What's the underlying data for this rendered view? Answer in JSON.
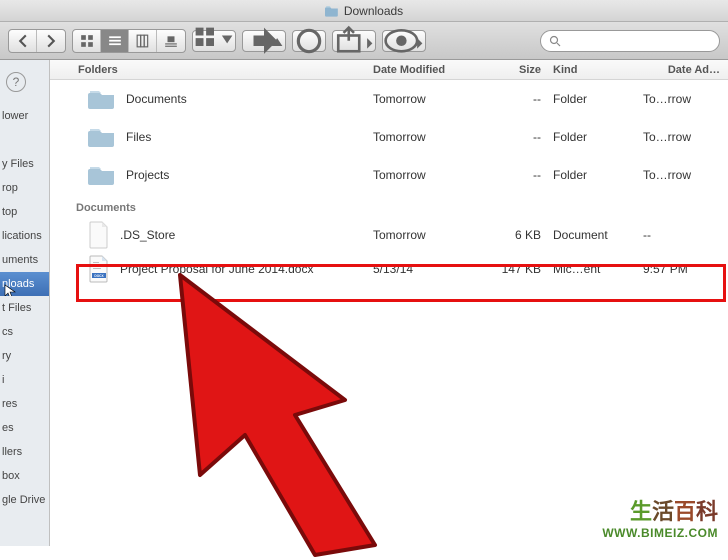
{
  "window": {
    "title": "Downloads"
  },
  "toolbar": {
    "search_placeholder": ""
  },
  "sidebar": {
    "items": [
      {
        "label": "lower"
      },
      {
        "label": ""
      },
      {
        "label": "y Files"
      },
      {
        "label": "rop"
      },
      {
        "label": "top"
      },
      {
        "label": "lications"
      },
      {
        "label": "uments"
      },
      {
        "label": "nloads"
      },
      {
        "label": "t Files"
      },
      {
        "label": "cs"
      },
      {
        "label": "ry"
      },
      {
        "label": "i"
      },
      {
        "label": "res"
      },
      {
        "label": "es"
      },
      {
        "label": "llers"
      },
      {
        "label": "box"
      },
      {
        "label": "gle Drive"
      }
    ],
    "selected_index": 7
  },
  "columns": {
    "folders_label": "Folders",
    "date_modified": "Date Modified",
    "size": "Size",
    "kind": "Kind",
    "date_added": "Date Ad…"
  },
  "sections": [
    {
      "label": "Folders",
      "rows": [
        {
          "icon": "folder",
          "name": "Documents",
          "date": "Tomorrow",
          "size": "--",
          "kind": "Folder",
          "added": "To…rrow"
        },
        {
          "icon": "folder",
          "name": "Files",
          "date": "Tomorrow",
          "size": "--",
          "kind": "Folder",
          "added": "To…rrow"
        },
        {
          "icon": "folder",
          "name": "Projects",
          "date": "Tomorrow",
          "size": "--",
          "kind": "Folder",
          "added": "To…rrow"
        }
      ]
    },
    {
      "label": "Documents",
      "rows": [
        {
          "icon": "file",
          "name": ".DS_Store",
          "date": "Tomorrow",
          "size": "6 KB",
          "kind": "Document",
          "added": "--"
        },
        {
          "icon": "docx",
          "name": "Project Proposal for June 2014.docx",
          "date": "5/13/14",
          "size": "147 KB",
          "kind": "Mic…ent",
          "added": "9:57 PM"
        }
      ],
      "highlighted_row": 1
    }
  ],
  "watermark": {
    "chinese": "生活百科",
    "url": "WWW.BIMEIZ.COM"
  }
}
